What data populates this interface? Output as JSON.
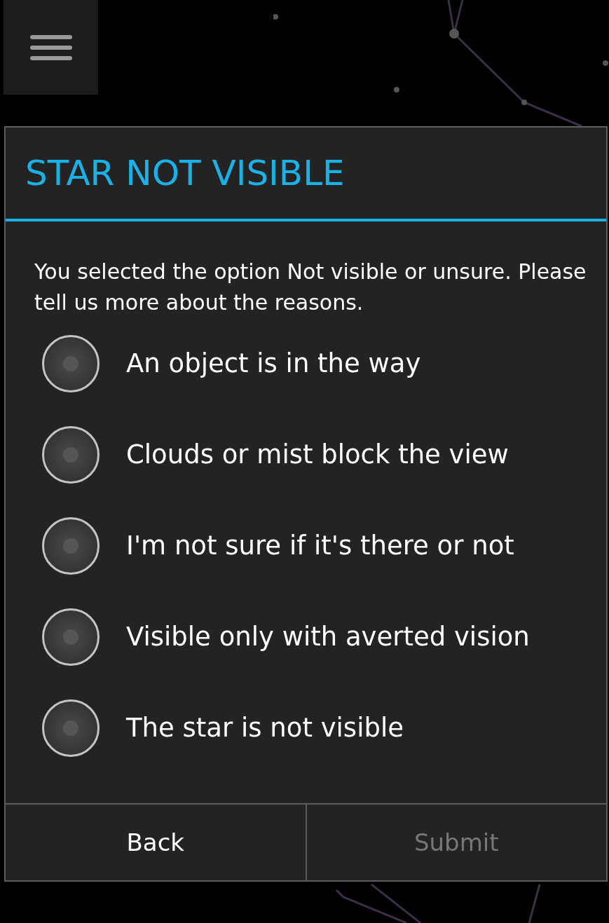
{
  "dialog": {
    "title": "STAR NOT VISIBLE",
    "message": "You selected the option Not visible or unsure. Please tell us more about the reasons.",
    "options": [
      {
        "label": "An object is in the way",
        "selected": false
      },
      {
        "label": "Clouds or mist block the view",
        "selected": false
      },
      {
        "label": "I'm not sure if it's there or not",
        "selected": false
      },
      {
        "label": "Visible only with averted vision",
        "selected": false
      },
      {
        "label": "The star is not visible",
        "selected": false
      }
    ],
    "buttons": [
      {
        "label": "Back",
        "disabled": false
      },
      {
        "label": "Submit",
        "disabled": true
      }
    ]
  }
}
